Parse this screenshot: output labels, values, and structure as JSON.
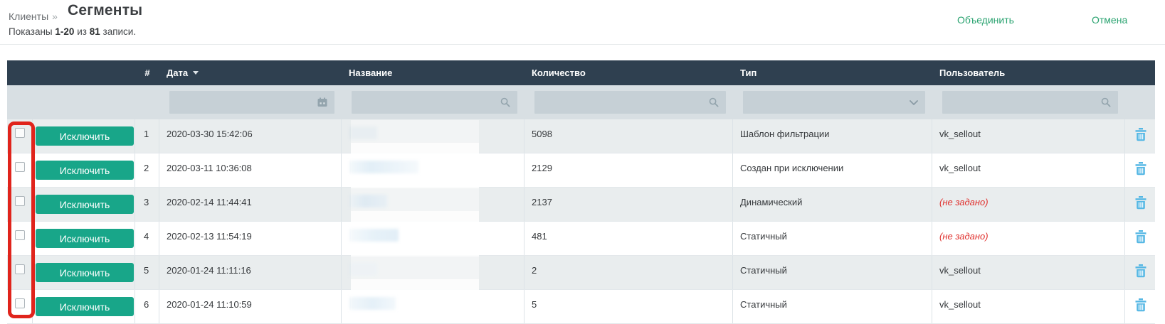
{
  "page": {
    "breadcrumb": "Клиенты",
    "breadcrumb_separator": "»",
    "title": "Сегменты",
    "summary": {
      "shown_label": "Показаны",
      "range": "1-20",
      "of_label": "из",
      "total": "81",
      "records_label": "записи."
    },
    "header_actions": {
      "merge_label": "Объединить",
      "cancel_label": "Отмена"
    }
  },
  "table": {
    "headers": {
      "number": "#",
      "date": "Дата",
      "name": "Название",
      "quantity": "Количество",
      "type": "Тип",
      "user": "Пользователь"
    },
    "filters": {
      "date_value": "",
      "name_value": "",
      "quantity_value": "",
      "type_value": "",
      "user_value": ""
    },
    "exclude_button_label": "Исключить",
    "rows": [
      {
        "number": "1",
        "date": "2020-03-30 15:42:06",
        "name_redacted": true,
        "quantity": "5098",
        "type": "Шаблон фильтрации",
        "user": "vk_sellout"
      },
      {
        "number": "2",
        "date": "2020-03-11 10:36:08",
        "name_redacted": true,
        "quantity": "2129",
        "type": "Создан при исключении",
        "user": "vk_sellout"
      },
      {
        "number": "3",
        "date": "2020-02-14 11:44:41",
        "name_redacted": true,
        "quantity": "2137",
        "type": "Динамический",
        "user": "(не задано)"
      },
      {
        "number": "4",
        "date": "2020-02-13 11:54:19",
        "name_redacted": true,
        "quantity": "481",
        "type": "Статичный",
        "user": "(не задано)"
      },
      {
        "number": "5",
        "date": "2020-01-24 11:11:16",
        "name_redacted": true,
        "quantity": "2",
        "type": "Статичный",
        "user": "vk_sellout"
      },
      {
        "number": "6",
        "date": "2020-01-24 11:10:59",
        "name_redacted": true,
        "quantity": "5",
        "type": "Статичный",
        "user": "vk_sellout"
      }
    ],
    "icons": {
      "date_filter": "calendar-icon",
      "text_filter": "search-icon",
      "type_filter": "chevron-down-icon",
      "sort_date": "sort-desc-caret",
      "row_delete": "trash-icon"
    }
  },
  "colors": {
    "table_header_bg": "#2f4050",
    "filter_row_bg": "#d8dfe3",
    "filter_input_bg": "#c6d0d6",
    "row_stripe": "#e9edee",
    "button_green": "#18a689",
    "link_green": "#2aa370",
    "trash_blue": "#55b7e4",
    "missing_value_red": "#e0302d",
    "annotation_red": "#e0241c"
  }
}
